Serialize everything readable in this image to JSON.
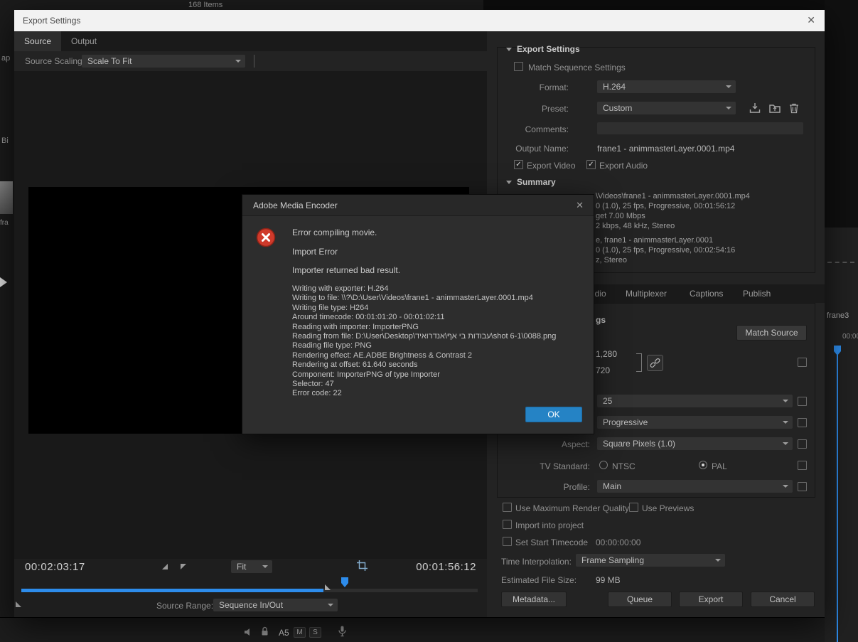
{
  "glyphs": {
    "close": "✕",
    "check": "✓"
  },
  "background": {
    "items_count": "168 Items",
    "left_fragments": [
      "ap",
      "Bi",
      "fra"
    ],
    "clip_label": "frane3",
    "ruler_timecode": "00:00",
    "track": {
      "name": "A5",
      "mute": "M",
      "solo": "S"
    }
  },
  "window": {
    "title": "Export Settings",
    "tabs": [
      {
        "label": "Source"
      },
      {
        "label": "Output"
      }
    ],
    "source_scaling_label": "Source Scaling:",
    "source_scaling_value": "Scale To Fit",
    "transport": {
      "current_time": "00:02:03:17",
      "duration": "00:01:56:12",
      "fit_value": "Fit",
      "source_range_label": "Source Range:",
      "source_range_value": "Sequence In/Out"
    }
  },
  "panel": {
    "export_settings_header": "Export Settings",
    "match_sequence_label": "Match Sequence Settings",
    "format_label": "Format:",
    "format_value": "H.264",
    "preset_label": "Preset:",
    "preset_value": "Custom",
    "comments_label": "Comments:",
    "output_name_label": "Output Name:",
    "output_name_value": "frane1 - animmasterLayer.0001.mp4",
    "export_video_label": "Export Video",
    "export_audio_label": "Export Audio",
    "summary_header": "Summary",
    "summary_lines": [
      "\\Videos\\frane1 - animmasterLayer.0001.mp4",
      "0 (1.0), 25 fps, Progressive, 00:01:56:12",
      "get 7.00 Mbps",
      "2 kbps, 48 kHz, Stereo",
      "e, frane1 - animmasterLayer.0001",
      "0 (1.0), 25 fps, Progressive, 00:02:54:16",
      "z, Stereo"
    ],
    "tabs": [
      {
        "label": "udio"
      },
      {
        "label": "Multiplexer"
      },
      {
        "label": "Captions"
      },
      {
        "label": "Publish"
      }
    ],
    "video_settings_fragment": "gs",
    "match_source_button": "Match Source",
    "width_value": "1,280",
    "height_value": "720",
    "frame_rate_value": "25",
    "field_order_value": "Progressive",
    "aspect_label": "Aspect:",
    "aspect_value": "Square Pixels (1.0)",
    "tv_standard_label": "TV Standard:",
    "ntsc_label": "NTSC",
    "pal_label": "PAL",
    "profile_label": "Profile:",
    "profile_value": "Main",
    "use_max_render_label": "Use Maximum Render Quality",
    "use_previews_label": "Use Previews",
    "import_into_project_label": "Import into project",
    "set_start_timecode_label": "Set Start Timecode",
    "set_start_timecode_value": "00:00:00:00",
    "time_interpolation_label": "Time Interpolation:",
    "time_interpolation_value": "Frame Sampling",
    "estimated_file_size_label": "Estimated File Size:",
    "estimated_file_size_value": "99 MB",
    "metadata_button": "Metadata...",
    "queue_button": "Queue",
    "export_button": "Export",
    "cancel_button": "Cancel"
  },
  "dialog": {
    "title": "Adobe Media Encoder",
    "message_lines": [
      "Error compiling movie.",
      "Import Error",
      "Importer returned bad result."
    ],
    "detail_lines": [
      "Writing with exporter: H.264",
      "Writing to file: \\\\?\\D:\\User\\Videos\\frane1 - animmasterLayer.0001.mp4",
      "Writing file type: H264",
      "Around timecode: 00:01:01:20 - 00:01:02:11",
      "Reading with importer: ImporterPNG",
      "Reading from file: D:\\User\\Desktop\\עבודות בי אף\\אנדרואיד\\shot 6-1\\0088.png",
      "Reading file type: PNG",
      "Rendering effect: AE.ADBE Brightness & Contrast 2",
      "Rendering at offset: 61.640 seconds",
      "Component: ImporterPNG of type Importer",
      "Selector: 47",
      "Error code: 22"
    ],
    "ok_button": "OK"
  }
}
